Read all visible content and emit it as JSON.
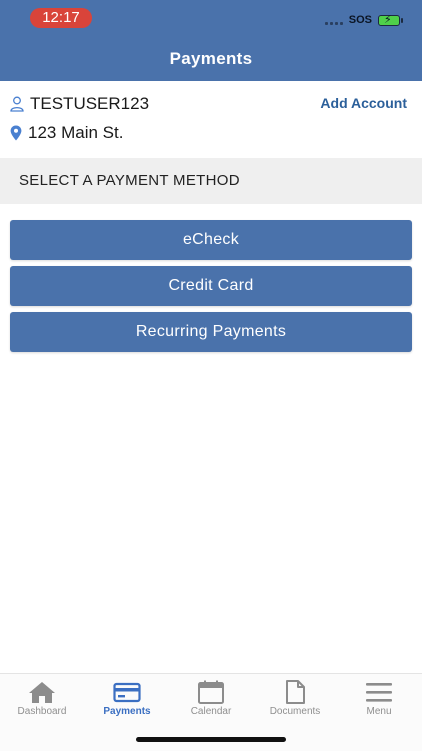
{
  "status": {
    "time": "12:17",
    "carrier": "SOS"
  },
  "header": {
    "title": "Payments"
  },
  "account": {
    "username": "TESTUSER123",
    "add_label": "Add Account",
    "address": "123 Main St."
  },
  "section": {
    "title": "SELECT A PAYMENT METHOD"
  },
  "methods": [
    "eCheck",
    "Credit Card",
    "Recurring Payments"
  ],
  "tabs": [
    {
      "label": "Dashboard",
      "icon": "home-icon",
      "active": false
    },
    {
      "label": "Payments",
      "icon": "credit-card-icon",
      "active": true
    },
    {
      "label": "Calendar",
      "icon": "calendar-icon",
      "active": false
    },
    {
      "label": "Documents",
      "icon": "document-icon",
      "active": false
    },
    {
      "label": "Menu",
      "icon": "menu-icon",
      "active": false
    }
  ],
  "colors": {
    "brand": "#4a72ab",
    "active_tab": "#3b6fc2",
    "link": "#2b5f9a"
  }
}
